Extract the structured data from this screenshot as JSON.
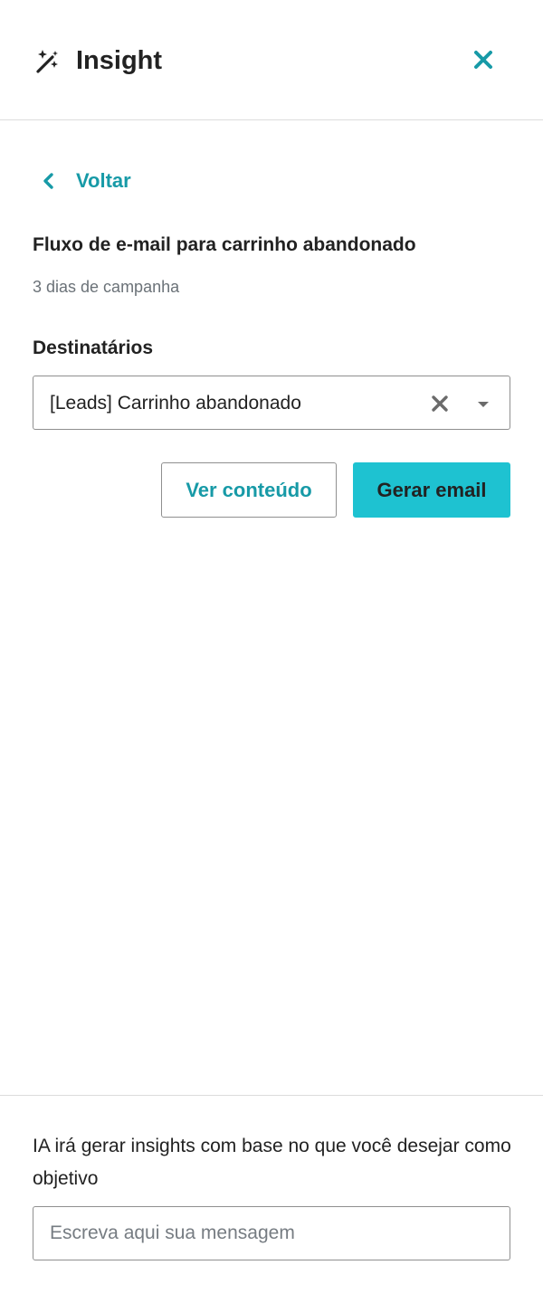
{
  "header": {
    "title": "Insight",
    "icon": "magic-wand-icon",
    "close_icon": "close-icon"
  },
  "nav": {
    "back_label": "Voltar",
    "back_icon": "chevron-left-icon"
  },
  "campaign": {
    "title": "Fluxo de e-mail para carrinho abandonado",
    "duration": "3 dias de campanha"
  },
  "recipients": {
    "label": "Destinatários",
    "selected_value": "[Leads] Carrinho abandonado",
    "clear_icon": "clear-icon",
    "caret_icon": "caret-down-icon"
  },
  "actions": {
    "view_content_label": "Ver conteúdo",
    "generate_email_label": "Gerar email"
  },
  "footer": {
    "hint": "IA irá gerar insights com base no que você desejar como objetivo",
    "message_value": "",
    "message_placeholder": "Escreva aqui sua mensagem"
  },
  "colors": {
    "accent": "#179aa7",
    "primary_button": "#1ec2d1",
    "text": "#222222",
    "muted_text": "#6b7278",
    "border": "#8f8f8f",
    "divider": "#dcdcdc"
  }
}
